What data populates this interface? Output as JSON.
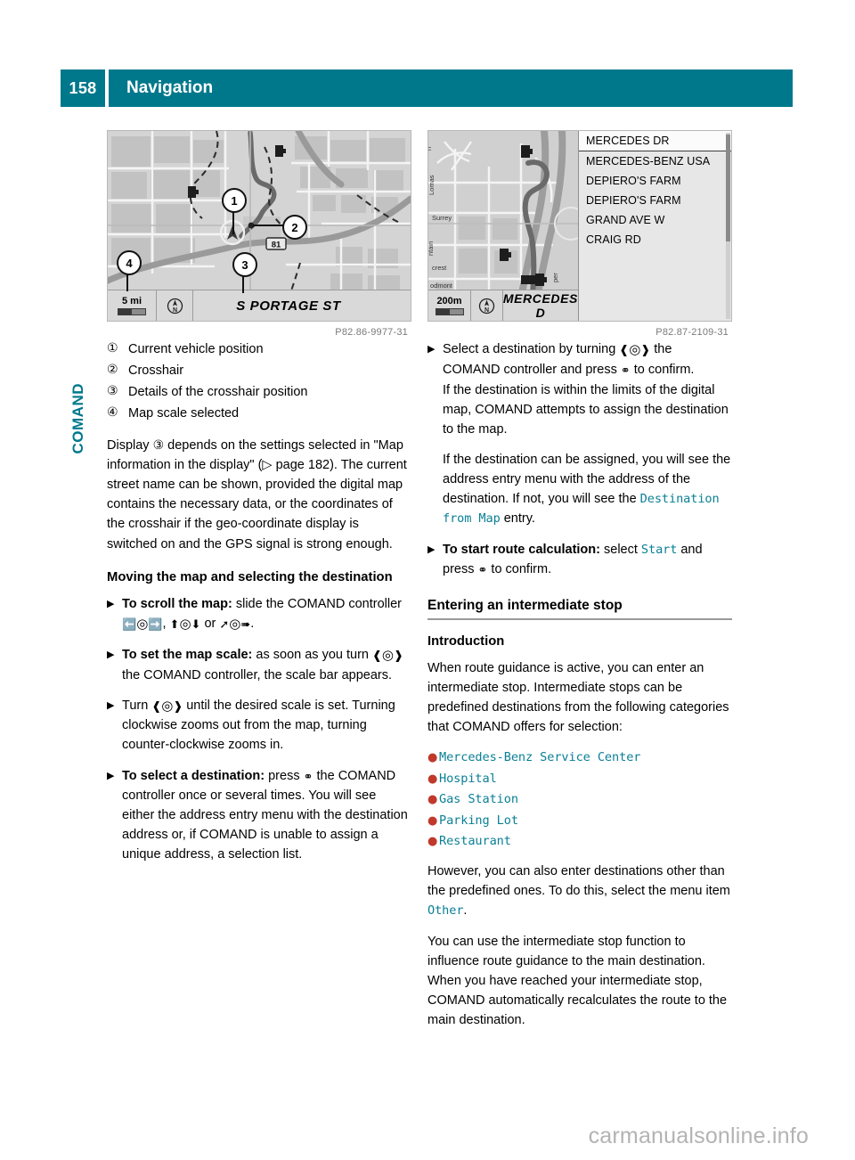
{
  "header": {
    "page_number": "158",
    "title": "Navigation"
  },
  "chapter_tab": "COMAND",
  "figures": {
    "left": {
      "caption": "P82.86-9977-31",
      "scale_label": "5 mi",
      "street_name": "S PORTAGE ST",
      "route_shield": "81",
      "callouts": [
        "1",
        "2",
        "3",
        "4"
      ],
      "compass_icon": "compass-icon"
    },
    "right": {
      "caption": "P82.87-2109-31",
      "scale_label": "200m",
      "street_name": "MERCEDES D",
      "compass_icon": "compass-icon",
      "poi_list": [
        "MERCEDES DR",
        "MERCEDES-BENZ USA",
        "DEPIERO'S FARM",
        "DEPIERO'S FARM",
        "GRAND AVE W",
        "CRAIG RD"
      ],
      "map_labels": [
        "Lomas",
        "Surrey",
        "crest",
        "odmont",
        "per",
        "n",
        "ntain"
      ]
    }
  },
  "left_column": {
    "legend": [
      {
        "marker": "①",
        "text": "Current vehicle position"
      },
      {
        "marker": "②",
        "text": "Crosshair"
      },
      {
        "marker": "③",
        "text": "Details of the crosshair position"
      },
      {
        "marker": "④",
        "text": "Map scale selected"
      }
    ],
    "display_paragraph": {
      "part1": "Display ",
      "circled": "③",
      "part2": " depends on the settings selected in \"Map information in the display\" (",
      "arrow": "▷",
      "part3": " page 182). The current street name can be shown, provided the digital map contains the necessary data, or the coordinates of the crosshair if the geo-coordinate display is switched on and the GPS signal is strong enough."
    },
    "heading_moving": "Moving the map and selecting the destination",
    "steps": [
      {
        "bold": "To scroll the map:",
        "text_a": " slide the COMAND controller ",
        "glyph_a": "slide-left-right",
        "text_b": ", ",
        "glyph_b": "slide-up-down",
        "text_c": " or ",
        "glyph_c": "slide-diagonal",
        "text_d": "."
      },
      {
        "bold": "To set the map scale:",
        "text_a": " as soon as you turn ",
        "glyph_a": "turn-controller",
        "text_b": " the COMAND controller, the scale bar appears."
      },
      {
        "bold": "",
        "text_a": "Turn ",
        "glyph_a": "turn-controller",
        "text_b": " until the desired scale is set. Turning clockwise zooms out from the map, turning counter-clockwise zooms in."
      },
      {
        "bold": "To select a destination:",
        "text_a": " press ",
        "glyph_a": "press-controller",
        "text_b": " the COMAND controller once or several times. You will see either the address entry menu with the destination address or, if COMAND is unable to assign a unique address, a selection list."
      }
    ]
  },
  "right_column": {
    "steps_top": [
      {
        "text_a": "Select a destination by turning ",
        "glyph_a": "turn-controller",
        "text_b": " the COMAND controller and press ",
        "glyph_b": "press-controller",
        "text_c": " to confirm.",
        "extra_lines": [
          "If the destination is within the limits of the digital map, COMAND attempts to assign the destination to the map."
        ]
      }
    ],
    "paragraph_assigned": {
      "part1": "If the destination can be assigned, you will see the address entry menu with the address of the destination. If not, you will see the ",
      "mono": "Destination from Map",
      "part2": " entry."
    },
    "step_start": {
      "bold": "To start route calculation:",
      "text_a": " select ",
      "mono": "Start",
      "text_b": " and press ",
      "glyph_a": "press-controller",
      "text_c": " to confirm."
    },
    "section_heading": "Entering an intermediate stop",
    "sub_heading": "Introduction",
    "intro_paragraph": "When route guidance is active, you can enter an intermediate stop. Intermediate stops can be predefined destinations from the following categories that COMAND offers for selection:",
    "categories": [
      "Mercedes-Benz Service Center",
      "Hospital",
      "Gas Station",
      "Parking Lot",
      "Restaurant"
    ],
    "paragraph_other": {
      "part1": "However, you can also enter destinations other than the predefined ones. To do this, select the menu item ",
      "mono": "Other",
      "part2": "."
    },
    "paragraph_influence": "You can use the intermediate stop function to influence route guidance to the main destination. When you have reached your intermediate stop, COMAND automatically recalculates the route to the main destination."
  },
  "footer": {
    "watermark": "carmanualsonline.info"
  },
  "colors": {
    "brand_teal": "#00788c",
    "mono_teal": "#0a7f96",
    "bullet_red": "#c0392b",
    "watermark_grey": "#b3b3b3"
  }
}
